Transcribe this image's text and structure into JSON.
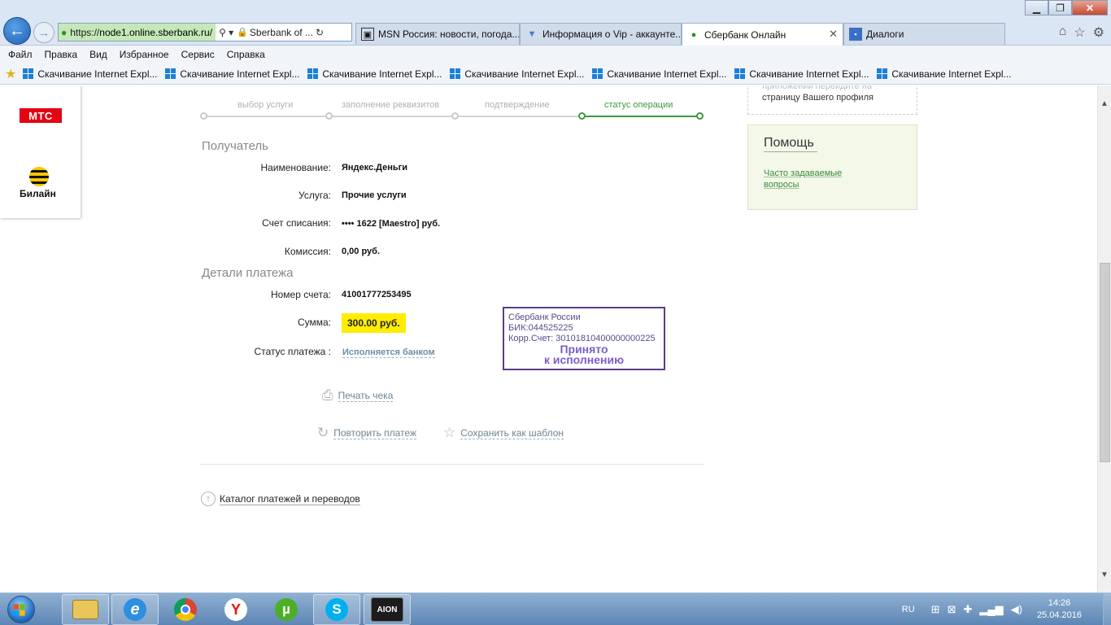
{
  "browser": {
    "url_prefix": "https://",
    "url_host": "node1.online.sberbank.ru/",
    "url_tools": "⚲ ▾",
    "site_identity": "Sberbank of ...",
    "tabs": [
      {
        "label": "MSN Россия: новости, погода..."
      },
      {
        "label": "Информация о Vip - аккаунте..."
      },
      {
        "label": "Сбербанк Онлайн"
      },
      {
        "label": "Диалоги"
      }
    ],
    "menu": [
      "Файл",
      "Правка",
      "Вид",
      "Избранное",
      "Сервис",
      "Справка"
    ],
    "favorites": [
      "Скачивание Internet Expl...",
      "Скачивание Internet Expl...",
      "Скачивание Internet Expl...",
      "Скачивание Internet Expl...",
      "Скачивание Internet Expl...",
      "Скачивание Internet Expl...",
      "Скачивание Internet Expl..."
    ]
  },
  "operators": {
    "mts": "МТС",
    "beeline": "Билайн"
  },
  "steps": [
    {
      "label": "выбор услуги",
      "active": false
    },
    {
      "label": "заполнение реквизитов",
      "active": false
    },
    {
      "label": "подтверждение",
      "active": false
    },
    {
      "label": "статус операции",
      "active": true
    }
  ],
  "recipient": {
    "title": "Получатель",
    "rows": [
      {
        "label": "Наименование:",
        "value": "Яндекс.Деньги"
      },
      {
        "label": "Услуга:",
        "value": "Прочие услуги"
      },
      {
        "label": "Счет списания:",
        "value": "•••• 1622  [Maestro]  руб."
      },
      {
        "label": "Комиссия:",
        "value": "0,00 руб."
      }
    ]
  },
  "details": {
    "title": "Детали платежа",
    "account_label": "Номер счета:",
    "account_value": "41001777253495",
    "sum_label": "Сумма:",
    "sum_value": "300.00 руб.",
    "status_label": "Статус платежа :",
    "status_value": "Исполняется банком"
  },
  "stamp": {
    "line1": "Сбербанк России",
    "line2": "БИК:044525225",
    "line3": "Корр.Счет: 30101810400000000225",
    "big1": "Принято",
    "big2": "к исполнению"
  },
  "actions": {
    "print": "Печать чека",
    "repeat": "Повторить платеж",
    "save_template": "Сохранить как шаблон",
    "catalog": "Каталог платежей и переводов"
  },
  "sidebar": {
    "profile_text_1": "приложении перейдите на",
    "profile_text_2": "страницу Вашего профиля",
    "help_title": "Помощь",
    "help_link": "Часто задаваемые вопросы"
  },
  "taskbar": {
    "lang": "RU",
    "time": "14:26",
    "date": "25.04.2016"
  },
  "colors": {
    "accent_green": "#3c9a3c",
    "highlight_yellow": "#ffed00",
    "stamp_purple": "#5a3d8a"
  }
}
